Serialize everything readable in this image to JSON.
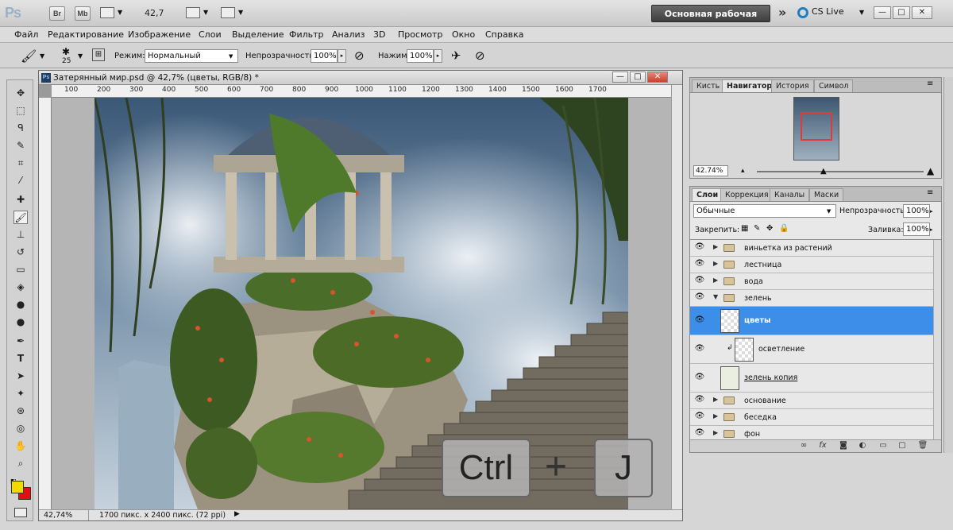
{
  "app": {
    "logo": "Ps",
    "bridge_label": "Br",
    "minibridge_label": "Mb",
    "zoom": "42,7",
    "workspace": "Основная рабочая среда",
    "cslive": "CS Live",
    "more_icon": "double-chevron-right-icon"
  },
  "window_controls": {
    "minimize": "—",
    "maximize": "□",
    "close": "✕"
  },
  "menu": [
    "Файл",
    "Редактирование",
    "Изображение",
    "Слои",
    "Выделение",
    "Фильтр",
    "Анализ",
    "3D",
    "Просмотр",
    "Окно",
    "Справка"
  ],
  "options": {
    "brush_size": "25",
    "mode_label": "Режим:",
    "mode_value": "Нормальный",
    "opacity_label": "Непрозрачность:",
    "opacity_value": "100%",
    "pressure_label": "Нажим:",
    "pressure_value": "100%"
  },
  "document": {
    "title": "Затерянный мир.psd @ 42,7% (цветы, RGB/8) *",
    "icon_label": "Ps",
    "ruler_h": [
      "100",
      "200",
      "300",
      "400",
      "500",
      "600",
      "700",
      "800",
      "900",
      "1000",
      "1100",
      "1200",
      "1300",
      "1400",
      "1500",
      "1600",
      "1700"
    ],
    "zoom_status": "42,74%",
    "size_status": "1700 пикс. x 2400 пикс. (72 ppi)"
  },
  "navigator_panel": {
    "tabs": [
      "Кисть",
      "Навигатор",
      "История",
      "Символ"
    ],
    "active_tab": "Навигатор",
    "zoom": "42.74%"
  },
  "layers_panel": {
    "tabs": [
      "Слои",
      "Коррекция",
      "Каналы",
      "Маски"
    ],
    "active_tab": "Слои",
    "blend_mode": "Обычные",
    "opacity_label": "Непрозрачность:",
    "opacity_value": "100%",
    "lock_label": "Закрепить:",
    "fill_label": "Заливка:",
    "fill_value": "100%",
    "layers": [
      {
        "name": "виньетка из растений",
        "type": "group"
      },
      {
        "name": "лестница",
        "type": "group"
      },
      {
        "name": "вода",
        "type": "group"
      },
      {
        "name": "зелень",
        "type": "group-open"
      },
      {
        "name": "цветы",
        "type": "layer",
        "selected": true
      },
      {
        "name": "осветление",
        "type": "layer-clipped"
      },
      {
        "name": "зелень копия",
        "type": "layer"
      },
      {
        "name": "основание",
        "type": "group"
      },
      {
        "name": "беседка",
        "type": "group"
      },
      {
        "name": "фон",
        "type": "group"
      }
    ]
  },
  "shortcut_overlay": {
    "key1": "Ctrl",
    "plus": "+",
    "key2": "J"
  },
  "colors": {
    "foreground": "#f5d800",
    "background": "#e01010",
    "selection": "#3d8ee8"
  }
}
